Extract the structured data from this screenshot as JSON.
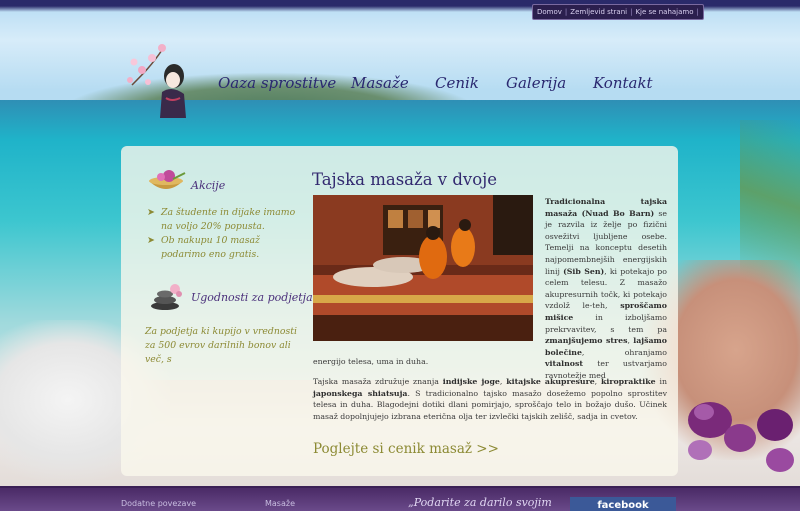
{
  "top_links": [
    "Domov",
    "Zemljevid strani",
    "Kje se nahajamo"
  ],
  "main_nav": [
    "Oaza sprostitve",
    "Masaže",
    "Cenik",
    "Galerija",
    "Kontakt"
  ],
  "sidebar": {
    "akcije": {
      "title": "Akcije",
      "items": [
        "Za študente in dijake imamo na voljo 20% popusta.",
        "Ob nakupu 10 masaž podarimo eno gratis."
      ]
    },
    "podjetja": {
      "title": "Ugodnosti za podjetja",
      "text": "Za podjetja ki kupijo v vrednosti za 500 evrov darilnih bonov ali več, s"
    }
  },
  "article": {
    "title": "Tajska masaža v dvoje",
    "p1_bold1": "Tradicionalna tajska masaža (Nuad Bo Barn)",
    "p1_t1": " se je razvila iz želje po fizični osvežitvi ljubljene osebe. Temelji na konceptu desetih najpomembnejših energijskih linij ",
    "p1_bold2": "(Sib Sen)",
    "p1_t2": ", ki potekajo po celem telesu. Z masažo akupresurnih točk, ki potekajo vzdolž le-teh, ",
    "p1_bold3": "sproščamo mišice",
    "p1_t3": " in izboljšamo prekrvavitev, s tem pa ",
    "p1_bold4": "zmanjšujemo stres",
    "p1_t4": ", ",
    "p1_bold5": "lajšamo bolečine",
    "p1_t5": ", ohranjamo ",
    "p1_bold6": "vitalnost",
    "p1_t6": " ter ustvarjamo ravnotežje med",
    "p1_end": "energijo telesa, uma in duha.",
    "p2_t1": "Tajska masaža združuje znanja ",
    "p2_b1": "indijske joge",
    "p2_t2": ", ",
    "p2_b2": "kitajske akupresure",
    "p2_t3": ", ",
    "p2_b3": "kiropraktike",
    "p2_t4": " in ",
    "p2_b4": "japonskega shiatsuja",
    "p2_t5": ". S tradicionalno tajsko masažo dosežemo popolno sprostitev telesa in duha. Blagodejni dotiki dlani pomirjajo, sproščajo telo in božajo dušo. Učinek masaž dopolnjujejo izbrana eterična olja ter izvlečki tajskih zelišč, sadja in cvetov.",
    "cta": "Poglejte si cenik masaž >>"
  },
  "footer": {
    "col1": "Dodatne povezave",
    "col2": "Masaže",
    "quote": "„Podarite za darilo svojim",
    "fb": "facebook"
  }
}
